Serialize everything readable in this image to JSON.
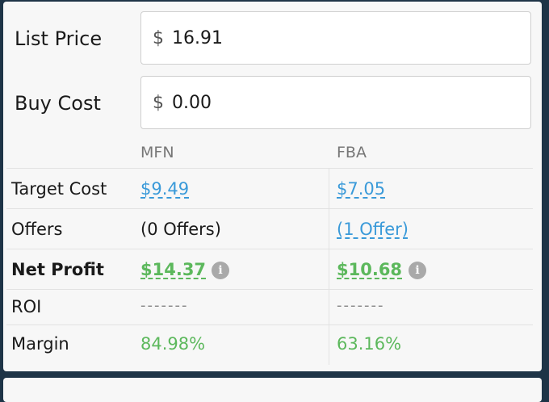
{
  "form": {
    "list_price": {
      "label": "List Price",
      "currency": "$",
      "value": "16.91"
    },
    "buy_cost": {
      "label": "Buy Cost",
      "currency": "$",
      "value": "0.00"
    }
  },
  "table": {
    "columns": [
      "MFN",
      "FBA"
    ],
    "rows": {
      "target_cost": {
        "label": "Target Cost",
        "mfn": "$9.49",
        "fba": "$7.05"
      },
      "offers": {
        "label": "Offers",
        "mfn": "(0 Offers)",
        "fba": "(1 Offer)"
      },
      "net_profit": {
        "label": "Net Profit",
        "mfn": "$14.37",
        "fba": "$10.68"
      },
      "roi": {
        "label": "ROI",
        "mfn": "-------",
        "fba": "-------"
      },
      "margin": {
        "label": "Margin",
        "mfn": "84.98%",
        "fba": "63.16%"
      }
    }
  },
  "icons": {
    "info_glyph": "i"
  },
  "colors": {
    "link": "#3a9ad9",
    "positive": "#5cb85c",
    "background": "#1e3447"
  }
}
